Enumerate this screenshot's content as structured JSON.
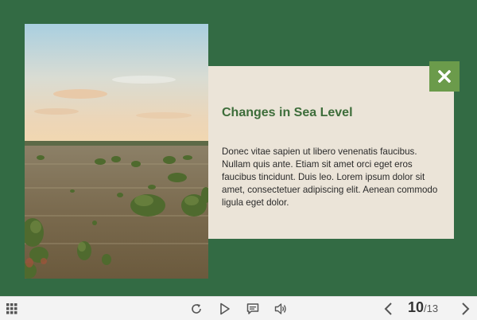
{
  "card": {
    "title": "Changes in Sea Level",
    "body": "Donec vitae sapien ut libero venenatis faucibus. Nullam quis ante. Etiam sit amet orci eget eros faucibus tincidunt. Duis leo. Lorem ipsum dolor sit amet, consectetuer adipiscing elit. Aenean commodo ligula eget dolor."
  },
  "photo": {
    "subject": "flooded-mangroves-photo"
  },
  "close": {
    "icon": "close-icon"
  },
  "toolbar": {
    "menu_icon": "grid-menu-icon",
    "replay_icon": "replay-icon",
    "play_icon": "play-icon",
    "notes_icon": "comment-icon",
    "volume_icon": "volume-icon",
    "prev_icon": "chevron-left-icon",
    "next_icon": "chevron-right-icon",
    "page_current": "10",
    "page_separator": "/",
    "page_total": "13"
  },
  "colors": {
    "slide_bg": "#336b44",
    "card_bg": "#ebe4d8",
    "title": "#3d6d3a",
    "close_bg": "#6b9b4b",
    "toolbar_bg": "#f3f3f3"
  }
}
